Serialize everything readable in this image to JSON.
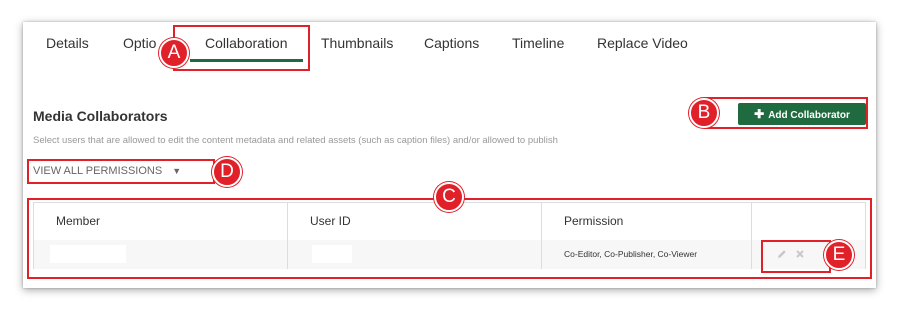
{
  "tabs": [
    {
      "label": "Details"
    },
    {
      "label": "Optio"
    },
    {
      "label": "Collaboration"
    },
    {
      "label": "Thumbnails"
    },
    {
      "label": "Captions"
    },
    {
      "label": "Timeline"
    },
    {
      "label": "Replace Video"
    }
  ],
  "callouts": {
    "a": "A",
    "b": "B",
    "c": "C",
    "d": "D",
    "e": "E"
  },
  "section": {
    "title": "Media Collaborators",
    "description": "Select users that are allowed to edit the content metadata and related assets (such as caption files) and/or allowed to publish"
  },
  "add_button": {
    "label": "Add Collaborator",
    "icon": "plus-icon"
  },
  "permissions_filter": {
    "label": "VIEW ALL PERMISSIONS",
    "icon": "chevron-down-icon"
  },
  "table": {
    "columns": [
      "Member",
      "User ID",
      "Permission",
      ""
    ],
    "rows": [
      {
        "member": "",
        "user_id": "",
        "permission": "Co-Editor, Co-Publisher, Co-Viewer"
      }
    ]
  },
  "colors": {
    "accent": "#1f6b3f",
    "callout": "#e0212a"
  }
}
